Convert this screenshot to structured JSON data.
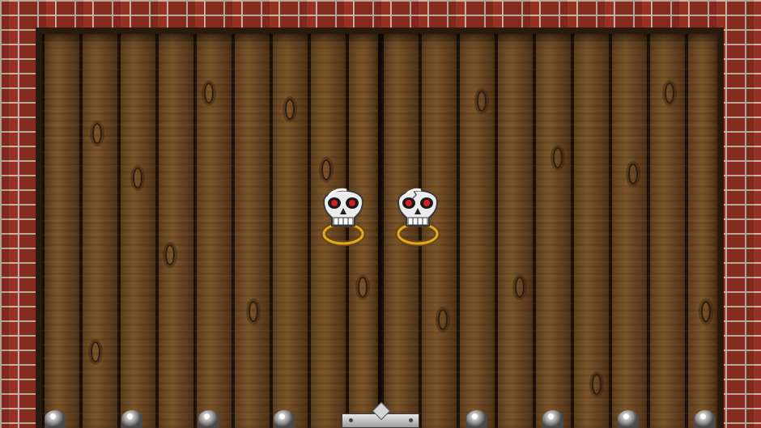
{
  "scene": {
    "name": "castle-gate",
    "colors": {
      "brick": "#8f2e22",
      "mortar": "#c9b9a6",
      "wood": "#6b4a26",
      "seam": "#0d0804",
      "skull": "#e6e6e6",
      "skull_eyes": "#d81e1e",
      "ring": "#d9a21b",
      "iron": "#9c9c9c"
    }
  },
  "knockers": [
    {
      "name": "left-skull-knocker",
      "icon": "skull-ring-icon"
    },
    {
      "name": "right-skull-knocker",
      "icon": "skull-ring-icon"
    }
  ],
  "studs": {
    "count": 8,
    "icon": "iron-stud-icon"
  }
}
